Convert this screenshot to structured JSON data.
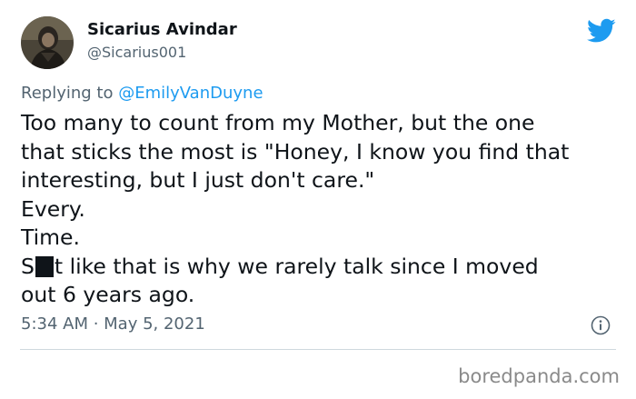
{
  "author": {
    "display_name": "Sicarius Avindar",
    "handle": "@Sicarius001",
    "avatar_icon": "profile-photo"
  },
  "reply": {
    "prefix": "Replying to ",
    "mention": "@EmilyVanDuyne"
  },
  "tweet": {
    "lines": [
      "Too many to count from my Mother, but the one",
      "that sticks the most is \"Honey, I know you find that",
      "interesting, but I just don't care.\"",
      "Every.",
      "Time."
    ],
    "censored_line": {
      "start": "S",
      "rest": "t like that is why we rarely talk since I moved"
    },
    "last_line": "out 6 years ago."
  },
  "meta": {
    "timestamp": "5:34 AM · May 5, 2021"
  },
  "watermark": "boredpanda.com",
  "colors": {
    "twitter_blue": "#1d9bf0",
    "secondary_text": "#536471",
    "primary_text": "#0f1419"
  }
}
